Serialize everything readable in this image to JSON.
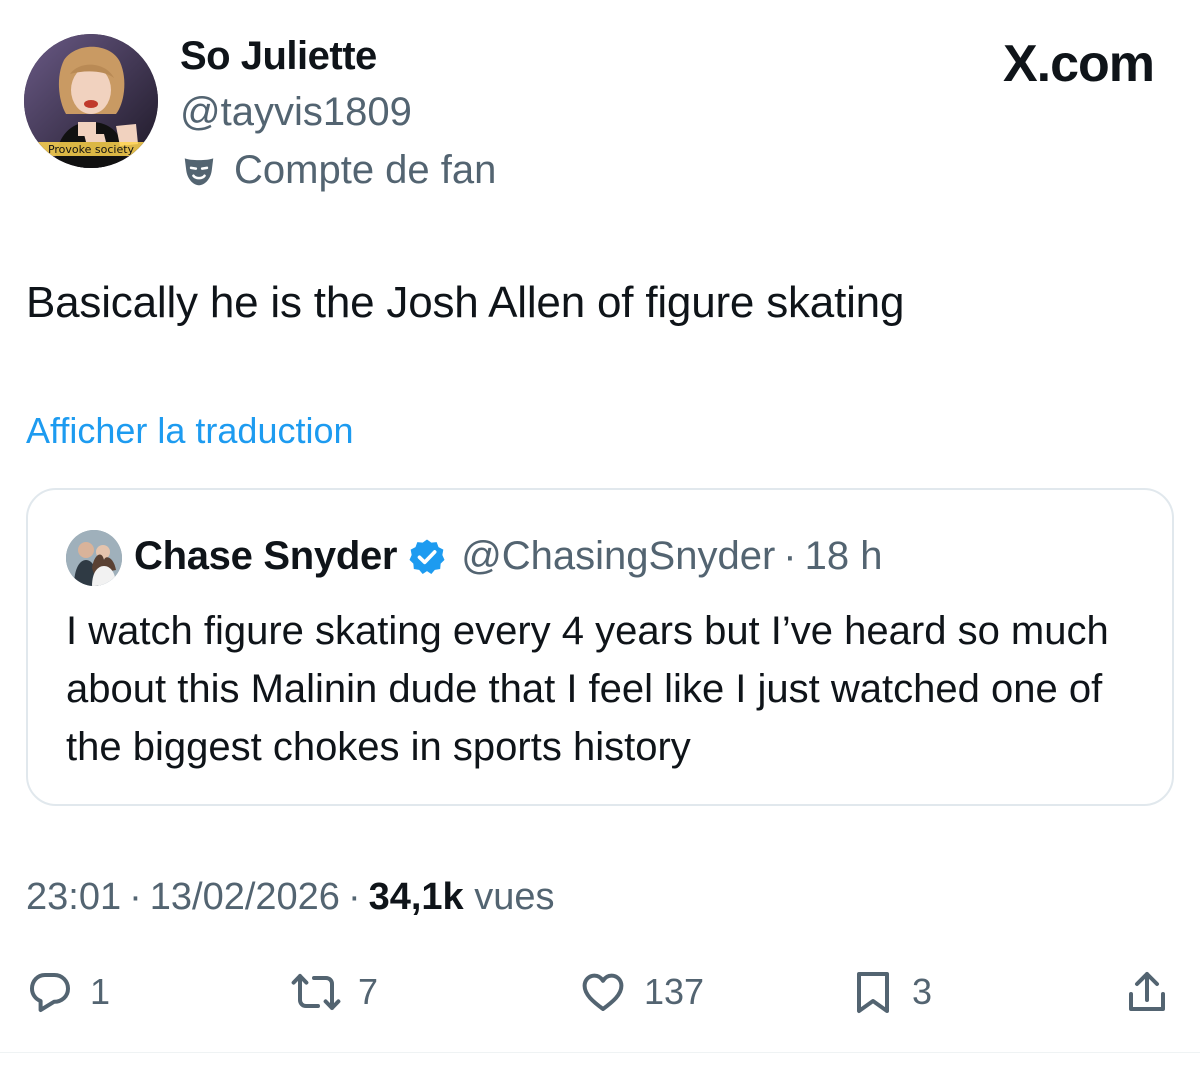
{
  "author": {
    "display_name": "So Juliette",
    "handle": "@tayvis1809",
    "badge_label": "Compte de fan",
    "badge_icon": "theater-mask-icon",
    "avatar_caption": "Provoke society"
  },
  "brand": "X.com",
  "tweet": {
    "text": "Basically he is the Josh Allen of figure skating",
    "translate_label": "Afficher la traduction"
  },
  "quoted_tweet": {
    "display_name": "Chase Snyder",
    "verified": true,
    "verified_icon": "verified-badge-icon",
    "handle": "@ChasingSnyder",
    "separator": "·",
    "time": "18 h",
    "text": "I watch figure skating every 4 years but I’ve heard so much about this Malinin dude that I feel like I just watched one of the biggest chokes in sports history"
  },
  "meta": {
    "time": "23:01",
    "separator": "·",
    "date": "13/02/2026",
    "views_count": "34,1k",
    "views_label": "vues"
  },
  "actions": {
    "reply": {
      "icon": "reply-icon",
      "count": "1"
    },
    "retweet": {
      "icon": "retweet-icon",
      "count": "7"
    },
    "like": {
      "icon": "heart-icon",
      "count": "137"
    },
    "bookmark": {
      "icon": "bookmark-icon",
      "count": "3"
    },
    "share": {
      "icon": "share-icon"
    }
  },
  "colors": {
    "link": "#1d9bf0",
    "secondary_text": "#536471",
    "primary_text": "#0f1419",
    "border": "#e1e8ed",
    "verified": "#1d9bf0"
  }
}
